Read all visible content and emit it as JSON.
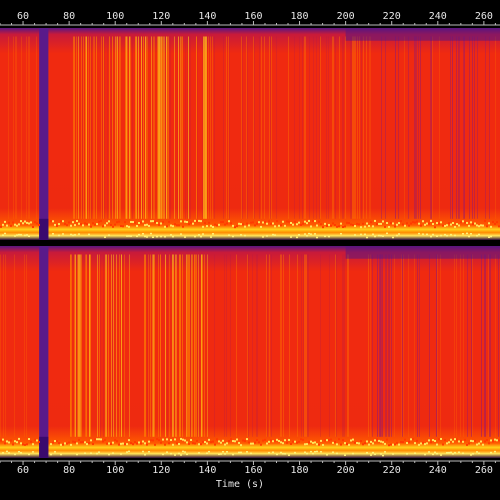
{
  "chart_data": {
    "type": "heatmap",
    "description_kind": "spectrogram",
    "xlabel": "Time (s)",
    "ylabel": "",
    "xlim": [
      50,
      267
    ],
    "x_ticks": [
      60,
      80,
      100,
      120,
      140,
      160,
      180,
      200,
      220,
      240,
      260
    ],
    "tick_labels": [
      "60",
      "80",
      "100",
      "120",
      "140",
      "160",
      "180",
      "200",
      "220",
      "240",
      "260"
    ],
    "channels": 2,
    "dark_band_range": [
      67,
      71
    ],
    "intensity_note_levels": {
      "colors": [
        "#000000",
        "#3a0a6e",
        "#7d1b8a",
        "#d41c1c",
        "#f02a00",
        "#ff7a00",
        "#ffd21a",
        "#ffff9a"
      ]
    }
  }
}
